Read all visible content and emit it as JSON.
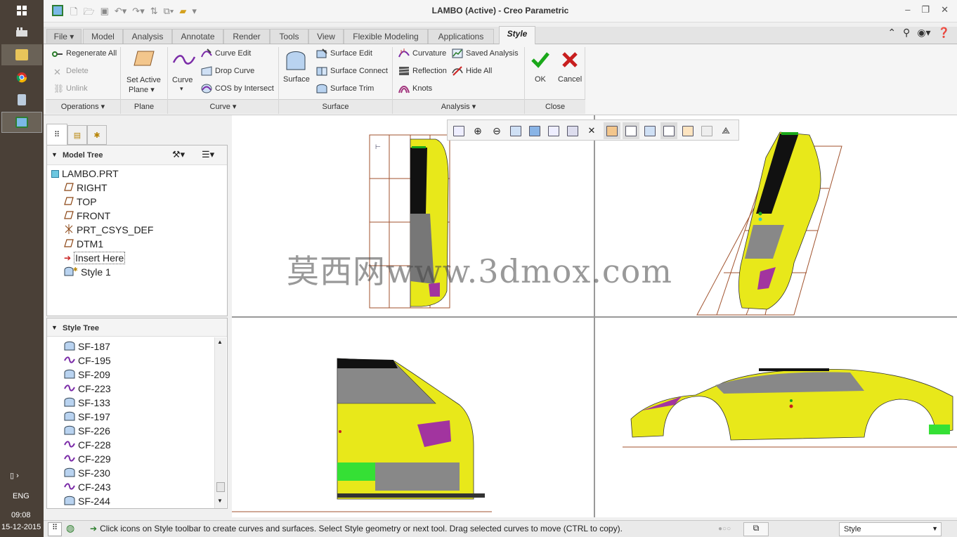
{
  "window": {
    "title": "LAMBO (Active) - Creo Parametric"
  },
  "taskbar": {
    "lang": "ENG",
    "time": "09:08",
    "date": "15-12-2015"
  },
  "tabs": [
    {
      "label": "File ▾"
    },
    {
      "label": "Model"
    },
    {
      "label": "Analysis"
    },
    {
      "label": "Annotate"
    },
    {
      "label": "Render"
    },
    {
      "label": "Tools"
    },
    {
      "label": "View"
    },
    {
      "label": "Flexible Modeling"
    },
    {
      "label": "Applications"
    },
    {
      "label": "Style"
    }
  ],
  "ribbon": {
    "operations": {
      "regenerate": "Regenerate All",
      "delete": "Delete",
      "unlink": "Unlink",
      "group": "Operations"
    },
    "plane": {
      "set_active_1": "Set Active",
      "set_active_2": "Plane",
      "group": "Plane"
    },
    "curve": {
      "curve": "Curve",
      "curve_edit": "Curve Edit",
      "drop_curve": "Drop Curve",
      "cos": "COS by Intersect",
      "group": "Curve"
    },
    "surface": {
      "surface": "Surface",
      "surface_edit": "Surface Edit",
      "surface_connect": "Surface Connect",
      "surface_trim": "Surface Trim",
      "group": "Surface"
    },
    "analysis": {
      "curvature": "Curvature",
      "reflection": "Reflection",
      "knots": "Knots",
      "saved": "Saved Analysis",
      "hide_all": "Hide All",
      "group": "Analysis"
    },
    "close": {
      "ok": "OK",
      "cancel": "Cancel",
      "group": "Close"
    }
  },
  "model_tree": {
    "title": "Model Tree",
    "items": [
      {
        "label": "LAMBO.PRT",
        "icon": "part-icon"
      },
      {
        "label": "RIGHT",
        "icon": "datum-plane-icon"
      },
      {
        "label": "TOP",
        "icon": "datum-plane-icon"
      },
      {
        "label": "FRONT",
        "icon": "datum-plane-icon"
      },
      {
        "label": "PRT_CSYS_DEF",
        "icon": "csys-icon"
      },
      {
        "label": "DTM1",
        "icon": "datum-plane-icon"
      },
      {
        "label": "Insert Here",
        "icon": "insert-arrow-icon"
      },
      {
        "label": "Style 1",
        "icon": "style-feature-icon"
      }
    ]
  },
  "style_tree": {
    "title": "Style Tree",
    "items": [
      {
        "label": "SF-187",
        "icon": "surface-icon"
      },
      {
        "label": "CF-195",
        "icon": "curve-icon"
      },
      {
        "label": "SF-209",
        "icon": "surface-icon"
      },
      {
        "label": "CF-223",
        "icon": "curve-icon"
      },
      {
        "label": "SF-133",
        "icon": "surface-icon"
      },
      {
        "label": "SF-197",
        "icon": "surface-icon"
      },
      {
        "label": "SF-226",
        "icon": "surface-icon"
      },
      {
        "label": "CF-228",
        "icon": "curve-icon"
      },
      {
        "label": "CF-229",
        "icon": "curve-icon"
      },
      {
        "label": "SF-230",
        "icon": "surface-icon"
      },
      {
        "label": "CF-243",
        "icon": "curve-icon"
      },
      {
        "label": "SF-244",
        "icon": "surface-icon"
      }
    ]
  },
  "watermark": "莫西网www.3dmox.com",
  "status": {
    "message": "Click icons on Style toolbar to create curves and surfaces. Select Style geometry or next tool. Drag selected curves to move (CTRL to copy).",
    "filter": "Style"
  },
  "colors": {
    "car_yellow": "#e8e81a",
    "accent_green": "#1aa81a",
    "cancel_red": "#c81e1e",
    "datum_brown": "#a0522d"
  }
}
